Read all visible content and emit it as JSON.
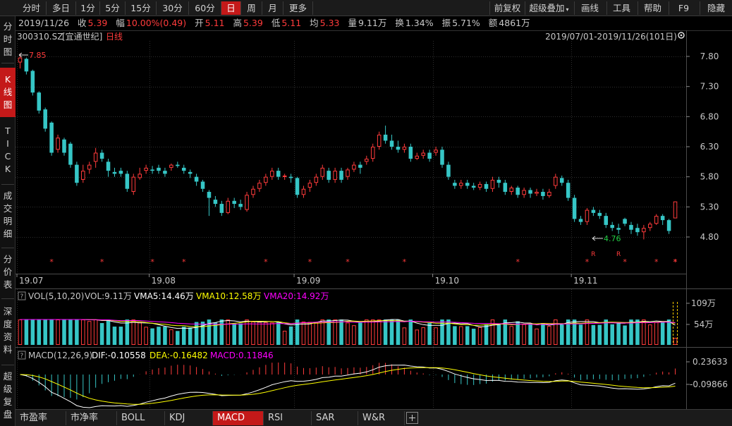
{
  "toolbar": {
    "periods": [
      "分时",
      "多日",
      "1分",
      "5分",
      "15分",
      "30分",
      "60分",
      "日",
      "周",
      "月",
      "更多"
    ],
    "active_period": "日",
    "right": [
      "前复权",
      "超级叠加",
      "画线",
      "工具",
      "帮助",
      "F9",
      "隐藏"
    ]
  },
  "sidebar": [
    "分时图",
    "K线图",
    "TICK",
    "成交明细",
    "分价表",
    "深度资料",
    "超级复盘"
  ],
  "sidebar_active": "K线图",
  "info": {
    "date": "2019/11/26",
    "close_label": "收",
    "close": "5.39",
    "change_label": "幅",
    "change": "10.00%(0.49)",
    "open_label": "开",
    "open": "5.11",
    "high_label": "高",
    "high": "5.39",
    "low_label": "低",
    "low": "5.11",
    "avg_label": "均",
    "avg": "5.33",
    "volume_label": "量",
    "volume": "9.11万",
    "turnover_label": "换",
    "turnover": "1.34%",
    "amplitude_label": "振",
    "amplitude": "5.71%",
    "amount_label": "额",
    "amount": "4861万"
  },
  "stock": {
    "code": "300310.SZ",
    "name": "[宜通世纪]",
    "period_label": "日线"
  },
  "range_label": "2019/07/01-2019/11/26(101日)",
  "max_label": "7.85",
  "min_label": "4.76",
  "star_symbol": "*",
  "r_label": "R",
  "colors": {
    "up": "#ff3b3b",
    "down": "#36c6c6",
    "vma5": "#ffffff",
    "vma10": "#ffff00",
    "vma20": "#ff00ff",
    "dif": "#ffffff",
    "dea": "#ffff00",
    "bg": "#000000",
    "grid": "#2e2e2e"
  },
  "price_axis": [
    7.8,
    7.3,
    6.8,
    6.3,
    5.8,
    5.3,
    4.8
  ],
  "month_labels": [
    "19.07",
    "19.08",
    "19.09",
    "19.10",
    "19.11"
  ],
  "vol_legend": {
    "title": "VOL(5,10,20)",
    "vol": "VOL:9.11万",
    "vma5": "VMA5:14.46万",
    "vma10": "VMA10:12.58万",
    "vma20": "VMA20:14.92万"
  },
  "vol_axis": [
    "109万",
    "54万"
  ],
  "macd_legend": {
    "title": "MACD(12,26,9)",
    "dif": "DIF:-0.10558",
    "dea": "DEA:-0.16482",
    "macd": "MACD:0.11846"
  },
  "macd_axis": [
    "0.23633",
    "-0.09866"
  ],
  "bottom_tabs": [
    "市盈率",
    "市净率",
    "BOLL",
    "KDJ",
    "MACD",
    "RSI",
    "SAR",
    "W&R"
  ],
  "bottom_active": "MACD",
  "add_tab_icon": "plus-icon",
  "chart_data": {
    "type": "candlestick",
    "title": "300310.SZ [宜通世纪] 日线",
    "x_range": "2019/07/01-2019/11/26",
    "ylim": [
      4.5,
      7.95
    ],
    "candles": [
      [
        7.7,
        7.78,
        7.6,
        7.85
      ],
      [
        7.76,
        7.55,
        7.5,
        7.78
      ],
      [
        7.56,
        7.2,
        7.15,
        7.58
      ],
      [
        7.2,
        6.9,
        6.85,
        7.22
      ],
      [
        6.92,
        6.6,
        6.55,
        6.95
      ],
      [
        6.7,
        6.2,
        6.15,
        6.72
      ],
      [
        6.25,
        6.45,
        6.2,
        6.5
      ],
      [
        6.42,
        6.2,
        6.15,
        6.45
      ],
      [
        6.35,
        6.0,
        5.95,
        6.38
      ],
      [
        6.0,
        5.7,
        5.65,
        6.05
      ],
      [
        5.75,
        5.9,
        5.7,
        6.0
      ],
      [
        5.92,
        6.0,
        5.85,
        6.05
      ],
      [
        6.05,
        6.2,
        5.95,
        6.28
      ],
      [
        6.2,
        6.1,
        6.05,
        6.25
      ],
      [
        6.05,
        5.9,
        5.8,
        6.1
      ],
      [
        5.88,
        5.85,
        5.8,
        5.95
      ],
      [
        5.9,
        5.85,
        5.8,
        5.95
      ],
      [
        5.85,
        5.6,
        5.55,
        5.9
      ],
      [
        5.55,
        5.8,
        5.5,
        5.85
      ],
      [
        5.78,
        5.85,
        5.75,
        5.95
      ],
      [
        5.9,
        5.95,
        5.85,
        6.0
      ],
      [
        5.92,
        5.9,
        5.85,
        5.98
      ],
      [
        5.95,
        5.9,
        5.85,
        6.0
      ],
      [
        5.9,
        5.85,
        5.8,
        5.95
      ],
      [
        5.95,
        6.0,
        5.9,
        6.02
      ],
      [
        6.0,
        5.98,
        5.95,
        6.05
      ],
      [
        5.95,
        5.9,
        5.85,
        6.0
      ],
      [
        5.88,
        5.85,
        5.78,
        5.92
      ],
      [
        5.8,
        5.72,
        5.65,
        5.85
      ],
      [
        5.72,
        5.6,
        5.55,
        5.75
      ],
      [
        5.55,
        5.45,
        5.15,
        5.58
      ],
      [
        5.42,
        5.35,
        5.3,
        5.48
      ],
      [
        5.35,
        5.2,
        5.15,
        5.4
      ],
      [
        5.2,
        5.4,
        5.18,
        5.45
      ],
      [
        5.4,
        5.35,
        5.28,
        5.45
      ],
      [
        5.35,
        5.3,
        5.25,
        5.42
      ],
      [
        5.25,
        5.5,
        5.22,
        5.55
      ],
      [
        5.5,
        5.6,
        5.45,
        5.65
      ],
      [
        5.6,
        5.7,
        5.55,
        5.75
      ],
      [
        5.7,
        5.8,
        5.65,
        5.85
      ],
      [
        5.8,
        5.9,
        5.75,
        5.95
      ],
      [
        5.9,
        5.8,
        5.75,
        5.95
      ],
      [
        5.8,
        5.82,
        5.75,
        5.85
      ],
      [
        5.8,
        5.78,
        5.7,
        5.85
      ],
      [
        5.78,
        5.5,
        5.45,
        5.8
      ],
      [
        5.5,
        5.6,
        5.45,
        5.65
      ],
      [
        5.62,
        5.7,
        5.55,
        5.75
      ],
      [
        5.7,
        5.8,
        5.65,
        5.85
      ],
      [
        5.8,
        5.95,
        5.75,
        6.0
      ],
      [
        5.9,
        5.75,
        5.7,
        5.95
      ],
      [
        5.75,
        5.9,
        5.7,
        5.95
      ],
      [
        5.9,
        5.75,
        5.7,
        5.95
      ],
      [
        5.8,
        5.92,
        5.75,
        5.95
      ],
      [
        5.92,
        6.0,
        5.88,
        6.05
      ],
      [
        6.0,
        5.95,
        5.85,
        6.05
      ],
      [
        6.05,
        6.1,
        6.0,
        6.15
      ],
      [
        6.1,
        6.3,
        6.05,
        6.35
      ],
      [
        6.3,
        6.5,
        6.25,
        6.55
      ],
      [
        6.5,
        6.4,
        6.35,
        6.65
      ],
      [
        6.4,
        6.3,
        6.25,
        6.5
      ],
      [
        6.3,
        6.25,
        6.2,
        6.4
      ],
      [
        6.25,
        6.3,
        6.2,
        6.35
      ],
      [
        6.3,
        6.1,
        6.05,
        6.35
      ],
      [
        6.1,
        6.15,
        6.08,
        6.2
      ],
      [
        6.15,
        6.2,
        6.1,
        6.25
      ],
      [
        6.2,
        6.1,
        6.05,
        6.25
      ],
      [
        6.2,
        6.25,
        6.15,
        6.3
      ],
      [
        6.25,
        6.0,
        5.95,
        6.3
      ],
      [
        6.0,
        5.8,
        5.75,
        6.05
      ],
      [
        5.7,
        5.65,
        5.6,
        5.75
      ],
      [
        5.65,
        5.7,
        5.6,
        5.75
      ],
      [
        5.7,
        5.65,
        5.6,
        5.75
      ],
      [
        5.65,
        5.62,
        5.58,
        5.7
      ],
      [
        5.62,
        5.68,
        5.58,
        5.72
      ],
      [
        5.68,
        5.6,
        5.55,
        5.72
      ],
      [
        5.6,
        5.75,
        5.55,
        5.8
      ],
      [
        5.75,
        5.7,
        5.62,
        5.8
      ],
      [
        5.7,
        5.55,
        5.5,
        5.75
      ],
      [
        5.55,
        5.62,
        5.5,
        5.65
      ],
      [
        5.62,
        5.5,
        5.45,
        5.65
      ],
      [
        5.5,
        5.58,
        5.45,
        5.62
      ],
      [
        5.58,
        5.52,
        5.45,
        5.62
      ],
      [
        5.52,
        5.55,
        5.48,
        5.6
      ],
      [
        5.55,
        5.48,
        5.42,
        5.6
      ],
      [
        5.48,
        5.55,
        5.45,
        5.6
      ],
      [
        5.65,
        5.8,
        5.6,
        5.85
      ],
      [
        5.78,
        5.7,
        5.65,
        5.82
      ],
      [
        5.7,
        5.45,
        5.4,
        5.75
      ],
      [
        5.45,
        5.1,
        5.05,
        5.5
      ],
      [
        5.1,
        5.05,
        5.0,
        5.15
      ],
      [
        5.05,
        5.25,
        5.0,
        5.28
      ],
      [
        5.25,
        5.2,
        5.15,
        5.3
      ],
      [
        5.2,
        5.15,
        5.1,
        5.25
      ],
      [
        5.15,
        5.0,
        4.95,
        5.2
      ],
      [
        5.0,
        4.95,
        4.9,
        5.05
      ],
      [
        4.95,
        4.92,
        4.85,
        5.02
      ],
      [
        5.1,
        5.02,
        4.98,
        5.12
      ],
      [
        5.0,
        4.92,
        4.85,
        5.05
      ],
      [
        4.95,
        4.88,
        4.82,
        5.02
      ],
      [
        4.88,
        4.95,
        4.76,
        5.0
      ],
      [
        4.95,
        5.02,
        4.9,
        5.05
      ],
      [
        5.02,
        5.15,
        5.0,
        5.18
      ],
      [
        5.15,
        5.08,
        5.0,
        5.18
      ],
      [
        5.08,
        4.9,
        4.85,
        5.1
      ],
      [
        5.11,
        5.39,
        5.11,
        5.39
      ]
    ]
  }
}
